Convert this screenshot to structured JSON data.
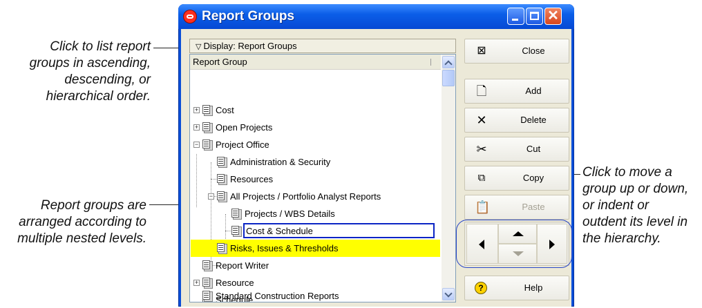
{
  "window": {
    "title": "Report Groups",
    "controls": [
      "minimize-icon",
      "maximize-icon",
      "close-icon"
    ]
  },
  "display_bar": {
    "label": "Display: Report Groups"
  },
  "tree": {
    "column_header": "Report Group",
    "rows": [
      {
        "label": "Cost",
        "expander": "+"
      },
      {
        "label": "Open Projects",
        "expander": "+"
      },
      {
        "label": "Project Office",
        "expander": "−"
      },
      {
        "label": "Administration & Security"
      },
      {
        "label": "Resources"
      },
      {
        "label": "All Projects / Portfolio Analyst Reports",
        "expander": "−"
      },
      {
        "label": "Projects / WBS Details"
      },
      {
        "label": "Cost & Schedule",
        "selected": true
      },
      {
        "label": "Risks, Issues & Thresholds"
      },
      {
        "label": "Report Writer"
      },
      {
        "label": "Resource",
        "expander": "+"
      },
      {
        "label": "Schedule"
      },
      {
        "label": "Standard Construction Reports"
      }
    ]
  },
  "buttons": {
    "close": "Close",
    "add": "Add",
    "delete": "Delete",
    "cut": "Cut",
    "copy": "Copy",
    "paste": "Paste",
    "help": "Help"
  },
  "callouts": {
    "display": [
      "Click to list report",
      "groups in ascending,",
      "descending, or",
      "hierarchical order."
    ],
    "levels": [
      "Report groups are",
      "arranged according to",
      "multiple nested levels."
    ],
    "move": [
      "Click to move a",
      "group up or down,",
      "or indent or",
      "outdent its level in",
      "the hierarchy."
    ]
  },
  "colors": {
    "highlight": "#ffff00",
    "selection_border": "#0a24c4",
    "titlebar": "#0b5ee8"
  }
}
